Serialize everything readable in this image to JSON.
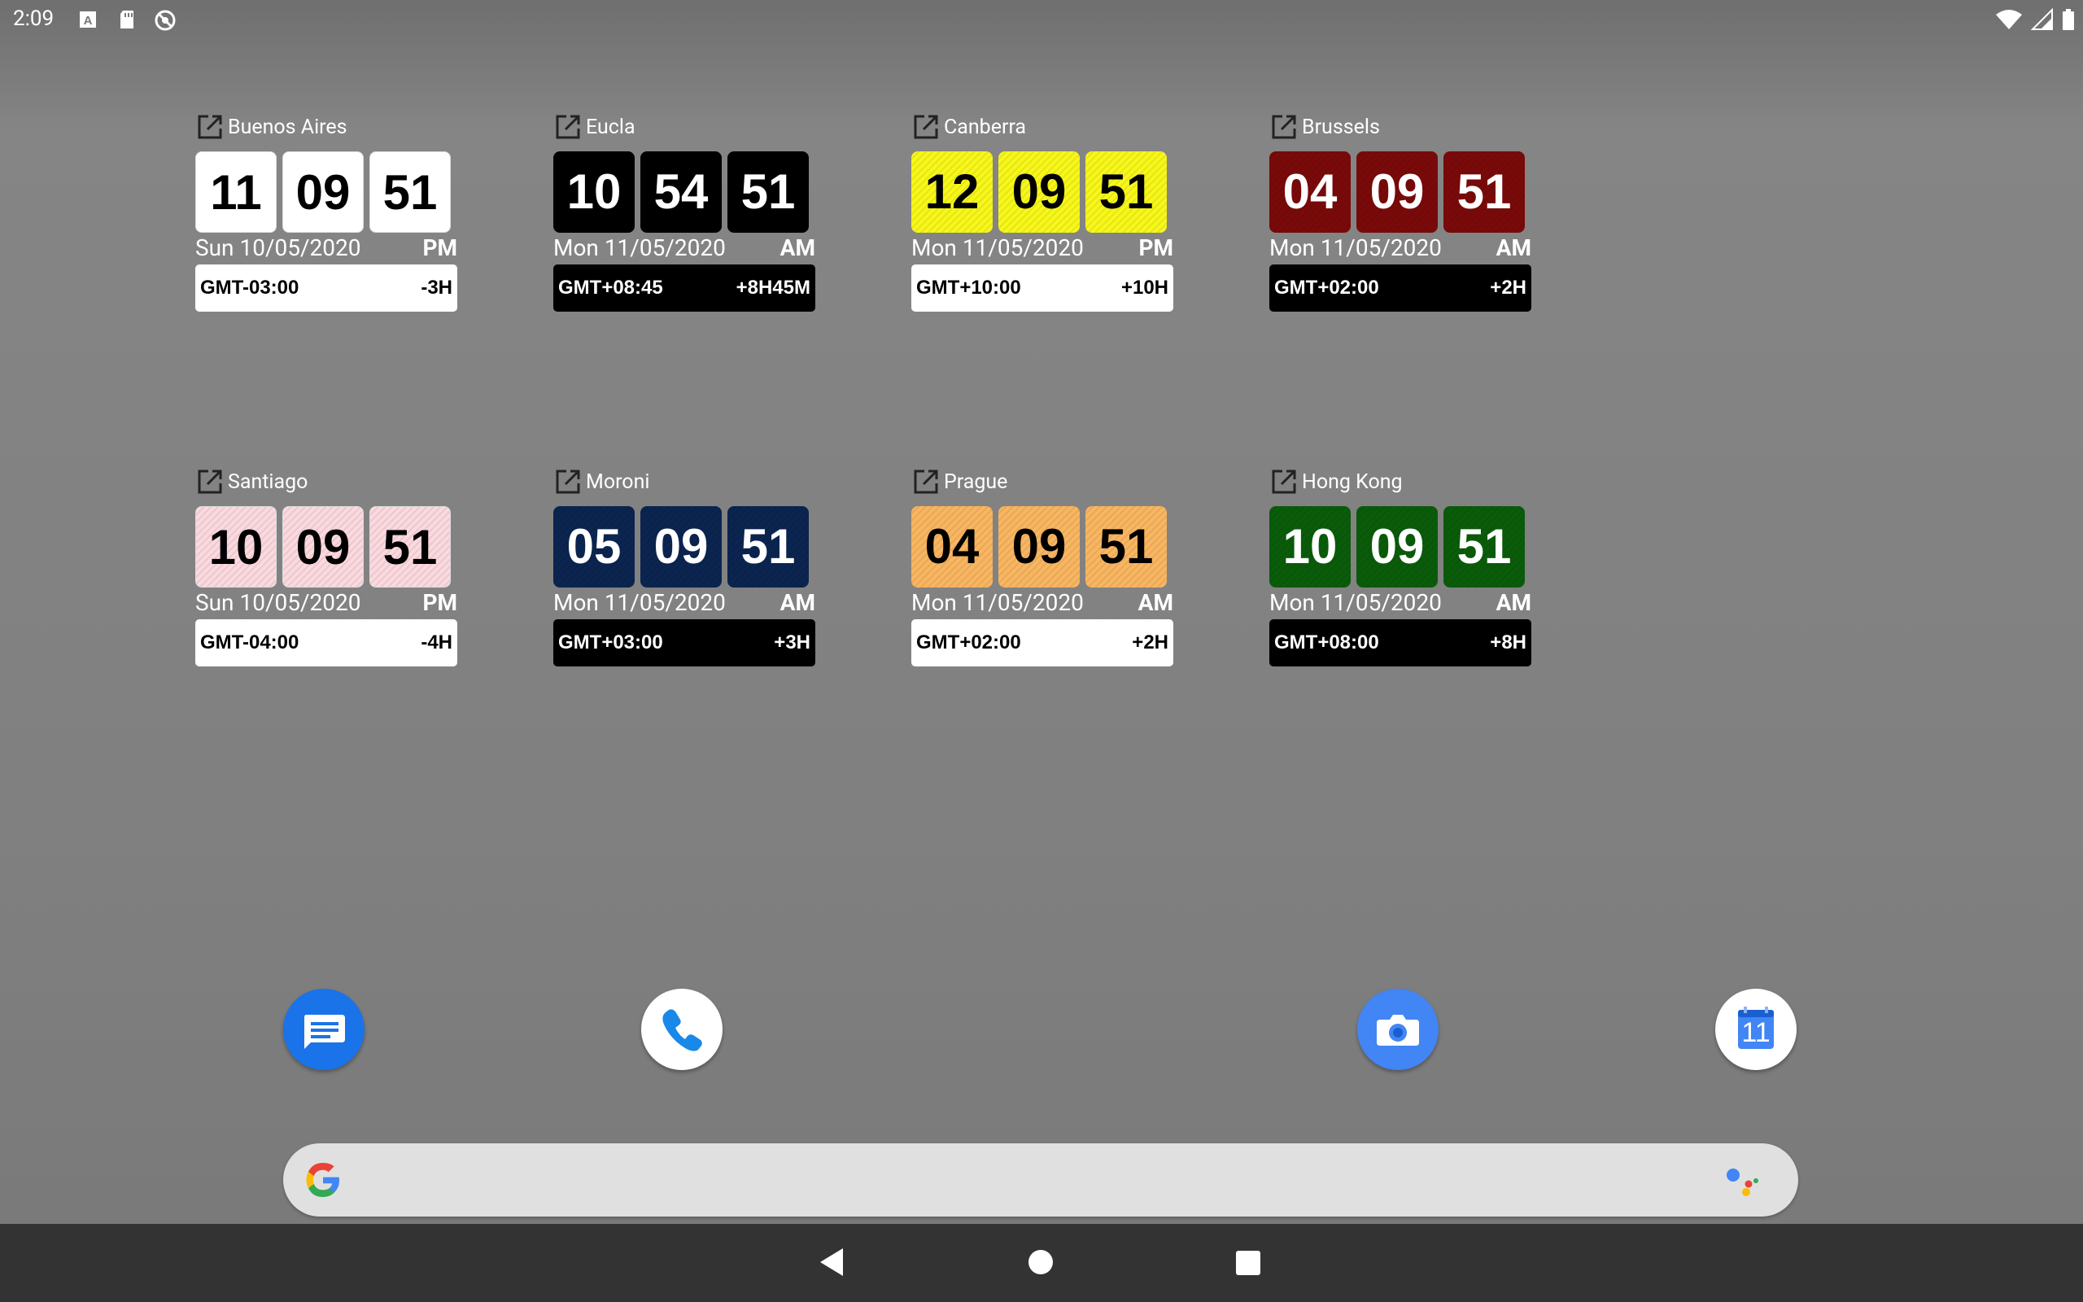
{
  "status_bar": {
    "time": "2:09",
    "left_icons": [
      "font-notification-icon",
      "sd-card-icon",
      "sync-off-icon"
    ],
    "right_icons": [
      "wifi-icon",
      "cell-signal-icon",
      "battery-icon"
    ]
  },
  "widgets": [
    {
      "city": "Buenos Aires",
      "hour": "11",
      "minute": "09",
      "second": "51",
      "date": "Sun 10/05/2020",
      "ampm": "PM",
      "gmt": "GMT-03:00",
      "diff": "-3H",
      "digit_bg": "#ffffff",
      "digit_fg": "#000000",
      "bar_bg": "#ffffff",
      "bar_fg": "#000000"
    },
    {
      "city": "Eucla",
      "hour": "10",
      "minute": "54",
      "second": "51",
      "date": "Mon 11/05/2020",
      "ampm": "AM",
      "gmt": "GMT+08:45",
      "diff": "+8H45M",
      "digit_bg": "#000000",
      "digit_fg": "#ffffff",
      "bar_bg": "#000000",
      "bar_fg": "#ffffff"
    },
    {
      "city": "Canberra",
      "hour": "12",
      "minute": "09",
      "second": "51",
      "date": "Mon 11/05/2020",
      "ampm": "PM",
      "gmt": "GMT+10:00",
      "diff": "+10H",
      "digit_bg": "#f7f71a",
      "digit_fg": "#000000",
      "bar_bg": "#ffffff",
      "bar_fg": "#000000"
    },
    {
      "city": "Brussels",
      "hour": "04",
      "minute": "09",
      "second": "51",
      "date": "Mon 11/05/2020",
      "ampm": "AM",
      "gmt": "GMT+02:00",
      "diff": "+2H",
      "digit_bg": "#7a0a0a",
      "digit_fg": "#ffffff",
      "bar_bg": "#000000",
      "bar_fg": "#ffffff"
    },
    {
      "city": "Santiago",
      "hour": "10",
      "minute": "09",
      "second": "51",
      "date": "Sun 10/05/2020",
      "ampm": "PM",
      "gmt": "GMT-04:00",
      "diff": "-4H",
      "digit_bg": "#fbd9df",
      "digit_fg": "#000000",
      "bar_bg": "#ffffff",
      "bar_fg": "#000000"
    },
    {
      "city": "Moroni",
      "hour": "05",
      "minute": "09",
      "second": "51",
      "date": "Mon 11/05/2020",
      "ampm": "AM",
      "gmt": "GMT+03:00",
      "diff": "+3H",
      "digit_bg": "#0b2550",
      "digit_fg": "#ffffff",
      "bar_bg": "#000000",
      "bar_fg": "#ffffff"
    },
    {
      "city": "Prague",
      "hour": "04",
      "minute": "09",
      "second": "51",
      "date": "Mon 11/05/2020",
      "ampm": "AM",
      "gmt": "GMT+02:00",
      "diff": "+2H",
      "digit_bg": "#f9b661",
      "digit_fg": "#000000",
      "bar_bg": "#ffffff",
      "bar_fg": "#000000"
    },
    {
      "city": "Hong Kong",
      "hour": "10",
      "minute": "09",
      "second": "51",
      "date": "Mon 11/05/2020",
      "ampm": "AM",
      "gmt": "GMT+08:00",
      "diff": "+8H",
      "digit_bg": "#0a5c0a",
      "digit_fg": "#ffffff",
      "bar_bg": "#000000",
      "bar_fg": "#ffffff"
    }
  ],
  "dock": [
    {
      "name": "messages-icon",
      "color": "#1a73e8"
    },
    {
      "name": "phone-icon",
      "color": "#ffffff"
    },
    {
      "name": "camera-icon",
      "color": "#4285f4"
    },
    {
      "name": "calendar-icon",
      "color": "#ffffff",
      "label": "11"
    }
  ],
  "search": {
    "logo": "google-g-icon",
    "assistant": "google-assistant-icon"
  },
  "nav": [
    "back-icon",
    "home-icon",
    "recents-icon"
  ]
}
